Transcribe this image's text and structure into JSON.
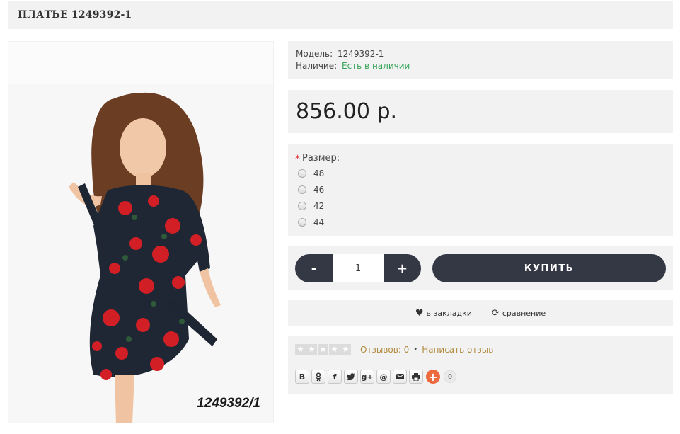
{
  "product": {
    "title": "ПЛАТЬЕ 1249392-1",
    "image_caption": "1249392/1"
  },
  "info": {
    "model_label": "Модель:",
    "model_value": "1249392-1",
    "stock_label": "Наличие:",
    "stock_value": "Есть в наличии",
    "stock_color": "#3aa55c"
  },
  "price": "856.00 р.",
  "options": {
    "required_mark": "*",
    "label": "Размер:",
    "sizes": [
      "48",
      "46",
      "42",
      "44"
    ]
  },
  "purchase": {
    "minus": "-",
    "quantity": "1",
    "plus": "+",
    "buy_label": "КУПИТЬ",
    "button_color": "#343744"
  },
  "actions": {
    "wishlist_label": "в закладки",
    "wishlist_icon": "heart-icon",
    "compare_label": "сравнение",
    "compare_icon": "refresh-icon"
  },
  "reviews": {
    "stars_filled": 0,
    "stars_total": 5,
    "count_label": "Отзывов: 0",
    "separator": "•",
    "write_label": "Написать отзыв",
    "link_color": "#b08b3f"
  },
  "share": {
    "buttons": [
      "В",
      "ok",
      "f",
      "twitter",
      "g+",
      "@",
      "mail",
      "print"
    ],
    "more": "+",
    "count": "0"
  }
}
